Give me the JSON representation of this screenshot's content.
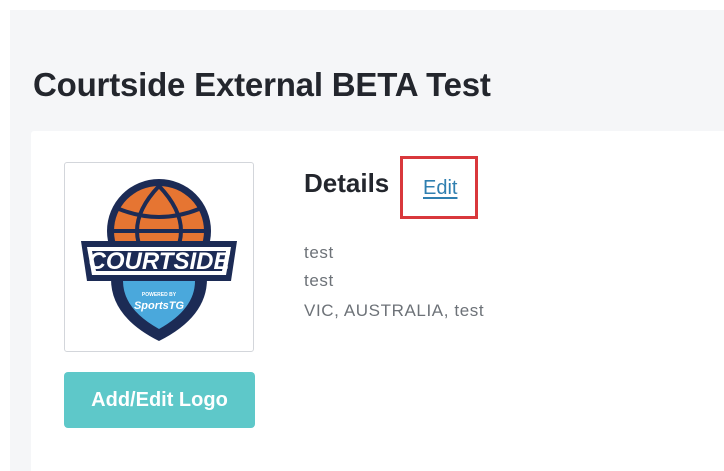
{
  "page": {
    "title": "Courtside External BETA Test"
  },
  "logo": {
    "text_main": "COURTSIDE",
    "text_powered": "POWERED BY",
    "text_brand": "SportsTG",
    "button_label": "Add/Edit Logo"
  },
  "details": {
    "heading": "Details",
    "edit_label": "Edit",
    "lines": [
      "test",
      "test",
      "VIC, AUSTRALIA, test"
    ]
  },
  "colors": {
    "accent_teal": "#5ec8c9",
    "link_blue": "#2f7fb0",
    "highlight_red": "#d9383c",
    "logo_navy": "#1c2b55",
    "logo_orange": "#e67532",
    "logo_sky": "#4aa8dc"
  }
}
